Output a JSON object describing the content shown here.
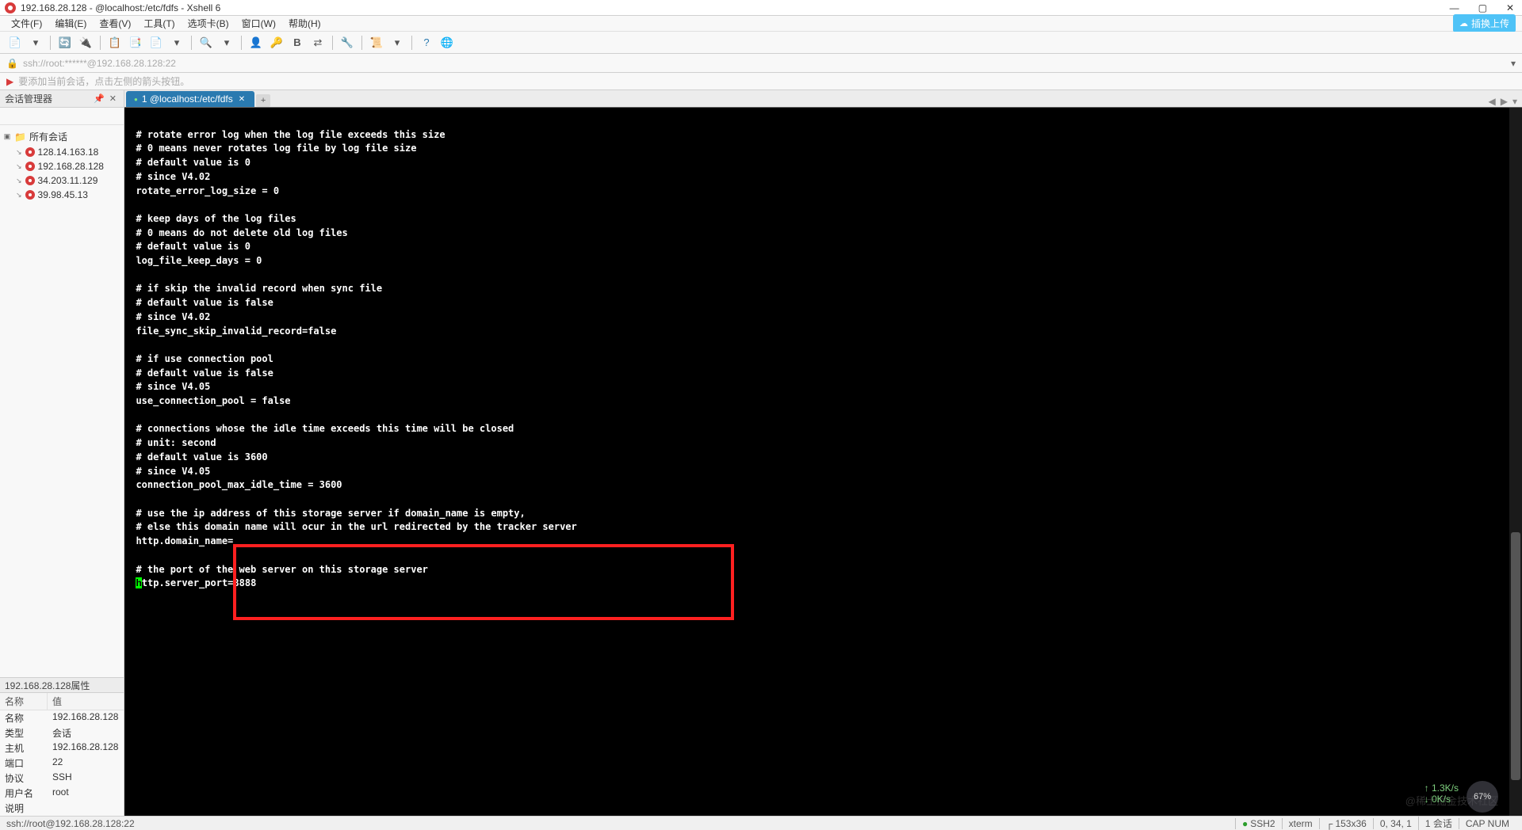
{
  "titlebar": {
    "title": "192.168.28.128 - @localhost:/etc/fdfs - Xshell 6"
  },
  "menubar": {
    "items": [
      "文件(F)",
      "编辑(E)",
      "查看(V)",
      "工具(T)",
      "选项卡(B)",
      "窗口(W)",
      "帮助(H)"
    ],
    "upload_label": "插换上传"
  },
  "addressbar": {
    "text": "ssh://root:******@192.168.28.128:22"
  },
  "hintbar": {
    "text": "要添加当前会话，点击左侧的箭头按钮。"
  },
  "sidebar": {
    "panel_title": "会话管理器",
    "root_label": "所有会话",
    "sessions": [
      "128.14.163.18",
      "192.168.28.128",
      "34.203.11.129",
      "39.98.45.13"
    ],
    "props_title": "192.168.28.128属性",
    "props_head_name": "名称",
    "props_head_value": "值",
    "props": [
      {
        "name": "名称",
        "value": "192.168.28.128"
      },
      {
        "name": "类型",
        "value": "会话"
      },
      {
        "name": "主机",
        "value": "192.168.28.128"
      },
      {
        "name": "端口",
        "value": "22"
      },
      {
        "name": "协议",
        "value": "SSH"
      },
      {
        "name": "用户名",
        "value": "root"
      },
      {
        "name": "说明",
        "value": ""
      }
    ]
  },
  "tabs": {
    "active_label": "1 @localhost:/etc/fdfs"
  },
  "terminal": {
    "lines": [
      "",
      "# rotate error log when the log file exceeds this size",
      "# 0 means never rotates log file by log file size",
      "# default value is 0",
      "# since V4.02",
      "rotate_error_log_size = 0",
      "",
      "# keep days of the log files",
      "# 0 means do not delete old log files",
      "# default value is 0",
      "log_file_keep_days = 0",
      "",
      "# if skip the invalid record when sync file",
      "# default value is false",
      "# since V4.02",
      "file_sync_skip_invalid_record=false",
      "",
      "# if use connection pool",
      "# default value is false",
      "# since V4.05",
      "use_connection_pool = false",
      "",
      "# connections whose the idle time exceeds this time will be closed",
      "# unit: second",
      "# default value is 3600",
      "# since V4.05",
      "connection_pool_max_idle_time = 3600",
      "",
      "# use the ip address of this storage server if domain_name is empty,",
      "# else this domain name will ocur in the url redirected by the tracker server",
      "http.domain_name=",
      "",
      "# the port of the web server on this storage server"
    ],
    "cursor_line_before": "",
    "cursor_char": "h",
    "cursor_line_after": "ttp.server_port=8888"
  },
  "statusbar": {
    "left": "ssh://root@192.168.28.128:22",
    "ssh": "SSH2",
    "term": "xterm",
    "size": "┌ 153x36",
    "pos": "0, 34, 1",
    "sess": "1 会话",
    "caps": "CAP  NUM"
  },
  "float": {
    "speed_up": "↑ 1.3K/s",
    "speed_down": "↓ 0K/s",
    "badge": "67%"
  },
  "watermark": "@稀土掘金技术社区"
}
